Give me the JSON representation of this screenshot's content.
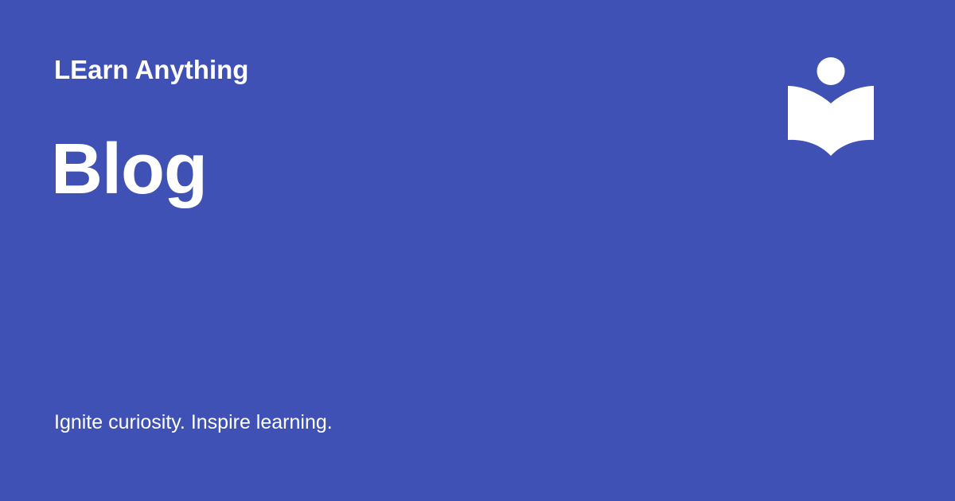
{
  "brand": {
    "name": "LEarn Anything",
    "logo_icon": "reader-book-icon"
  },
  "page": {
    "title": "Blog",
    "tagline": "Ignite curiosity. Inspire learning."
  },
  "colors": {
    "background": "#3f51b5",
    "foreground": "#ffffff"
  }
}
